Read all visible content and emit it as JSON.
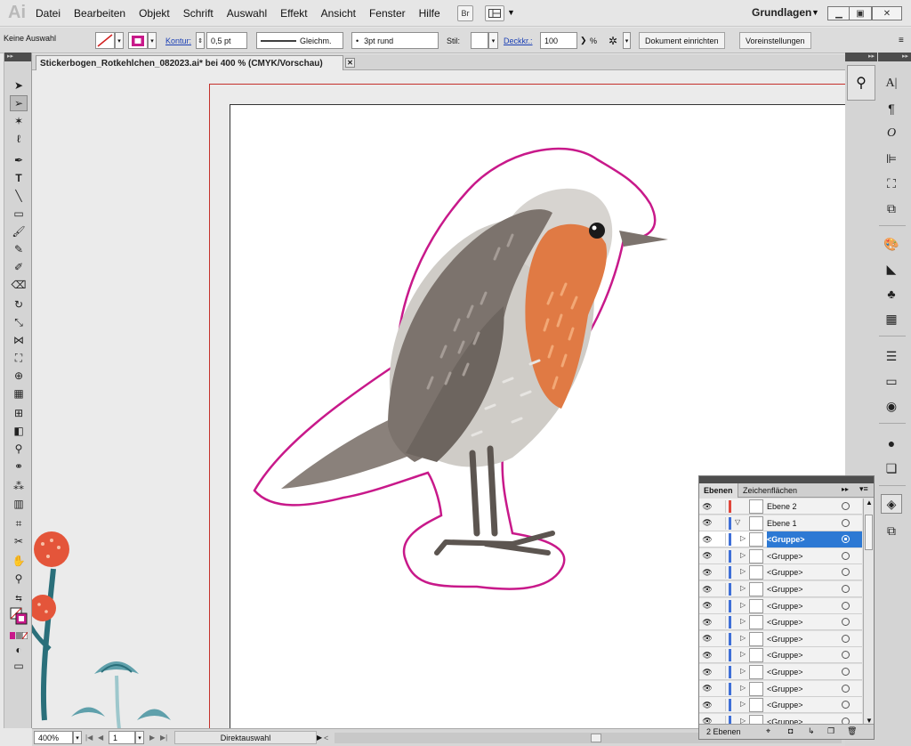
{
  "app": {
    "logo": "Ai"
  },
  "menu": [
    "Datei",
    "Bearbeiten",
    "Objekt",
    "Schrift",
    "Auswahl",
    "Effekt",
    "Ansicht",
    "Fenster",
    "Hilfe"
  ],
  "menubar_buttons": {
    "bridge": "Br"
  },
  "workspace": "Grundlagen",
  "controlbar": {
    "selection": "Keine Auswahl",
    "stroke_label": "Kontur:",
    "stroke_weight": "0,5 pt",
    "stroke_profile": "Gleichm.",
    "brush": "3pt rund",
    "style_label": "Stil:",
    "opacity_label": "Deckkr.:",
    "opacity_value": "100",
    "percent": "%",
    "doc_setup": "Dokument einrichten",
    "preferences": "Voreinstellungen"
  },
  "document_tab": "Stickerbogen_Rotkehlchen_082023.ai* bei 400 % (CMYK/Vorschau)",
  "status": {
    "zoom": "400%",
    "artboard": "1",
    "tool": "Direktauswahl"
  },
  "layers_panel": {
    "tab_layers": "Ebenen",
    "tab_artboards": "Zeichenflächen",
    "rows": [
      {
        "name": "Ebene 2",
        "indent": 0,
        "color": "#e0463b",
        "selected": false,
        "expandable": false
      },
      {
        "name": "Ebene 1",
        "indent": 0,
        "color": "#3e6fd8",
        "selected": false,
        "expandable": true,
        "expanded": true
      },
      {
        "name": "<Gruppe>",
        "indent": 1,
        "color": "#3e6fd8",
        "selected": true,
        "expandable": true
      },
      {
        "name": "<Gruppe>",
        "indent": 1,
        "color": "#3e6fd8",
        "selected": false,
        "expandable": true
      },
      {
        "name": "<Gruppe>",
        "indent": 1,
        "color": "#3e6fd8",
        "selected": false,
        "expandable": true
      },
      {
        "name": "<Gruppe>",
        "indent": 1,
        "color": "#3e6fd8",
        "selected": false,
        "expandable": true
      },
      {
        "name": "<Gruppe>",
        "indent": 1,
        "color": "#3e6fd8",
        "selected": false,
        "expandable": true
      },
      {
        "name": "<Gruppe>",
        "indent": 1,
        "color": "#3e6fd8",
        "selected": false,
        "expandable": true
      },
      {
        "name": "<Gruppe>",
        "indent": 1,
        "color": "#3e6fd8",
        "selected": false,
        "expandable": true
      },
      {
        "name": "<Gruppe>",
        "indent": 1,
        "color": "#3e6fd8",
        "selected": false,
        "expandable": true
      },
      {
        "name": "<Gruppe>",
        "indent": 1,
        "color": "#3e6fd8",
        "selected": false,
        "expandable": true
      },
      {
        "name": "<Gruppe>",
        "indent": 1,
        "color": "#3e6fd8",
        "selected": false,
        "expandable": true
      },
      {
        "name": "<Gruppe>",
        "indent": 1,
        "color": "#3e6fd8",
        "selected": false,
        "expandable": true
      },
      {
        "name": "<Gruppe>",
        "indent": 1,
        "color": "#3e6fd8",
        "selected": false,
        "expandable": true
      }
    ],
    "footer": "2 Ebenen"
  },
  "colors": {
    "cut_line": "#c8198a",
    "robin_breast": "#e07a44",
    "robin_back": "#7c736d",
    "robin_belly": "#cfccc7",
    "robin_head": "#d7d4d0",
    "selection_blue": "#2d79d4"
  }
}
